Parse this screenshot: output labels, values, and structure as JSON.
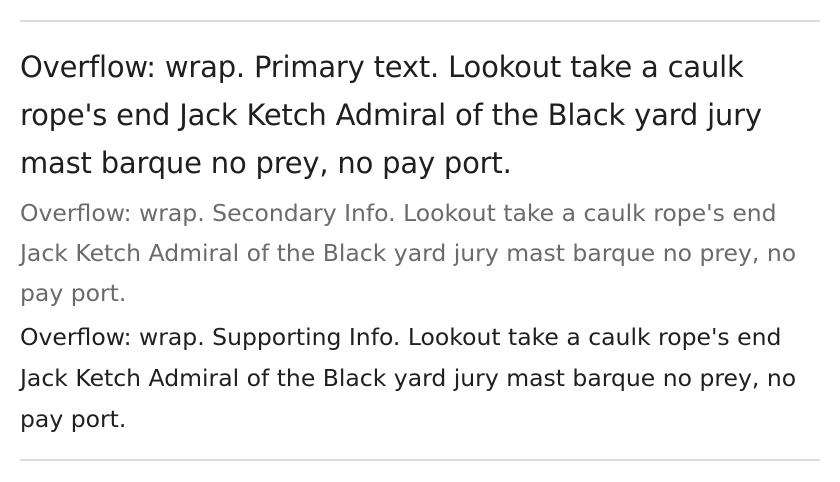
{
  "list_item": {
    "primary_text": "Overflow: wrap. Primary text. Lookout take a caulk rope's end Jack Ketch Admiral of the Black yard jury mast barque no prey, no pay port.",
    "secondary_text": "Overflow: wrap. Secondary Info. Lookout take a caulk rope's end Jack Ketch Admiral of the Black yard jury mast barque no prey, no pay port.",
    "supporting_text": "Overflow: wrap. Supporting Info. Lookout take a caulk rope's end Jack Ketch Admiral of the Black yard jury mast barque no prey, no pay port."
  },
  "colors": {
    "primary": "#1f1f1f",
    "secondary": "#6b6b6b",
    "supporting": "#202020",
    "divider": "#d7dde2"
  }
}
